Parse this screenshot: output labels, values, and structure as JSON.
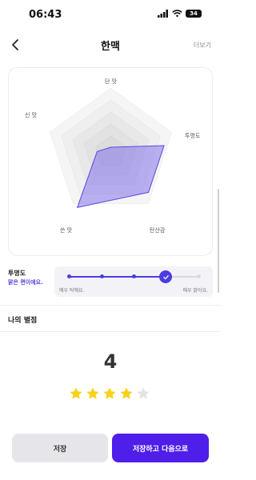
{
  "status_bar": {
    "time": "06:43",
    "battery": "34"
  },
  "header": {
    "title": "한맥",
    "more_label": "더보기"
  },
  "radar": {
    "labels": {
      "top": "단 맛",
      "right": "투명도",
      "bottom_right": "탄산감",
      "bottom_left": "쓴 맛",
      "left": "신 맛"
    },
    "fill_color": "#6f5bea"
  },
  "attribute": {
    "name": "투명도",
    "description": "맑은 편이에요.",
    "min_label": "매우 탁해요.",
    "max_label": "매우 맑아요.",
    "selected_step": 4,
    "total_steps": 5
  },
  "rating": {
    "title": "나의 별점",
    "value": "4",
    "stars_filled": 4,
    "stars_total": 5
  },
  "buttons": {
    "save": "저장",
    "save_next": "저장하고 다음으로"
  },
  "colors": {
    "accent": "#4f1ee8",
    "star": "#f5d31c",
    "star_empty": "#e4e4e4"
  }
}
